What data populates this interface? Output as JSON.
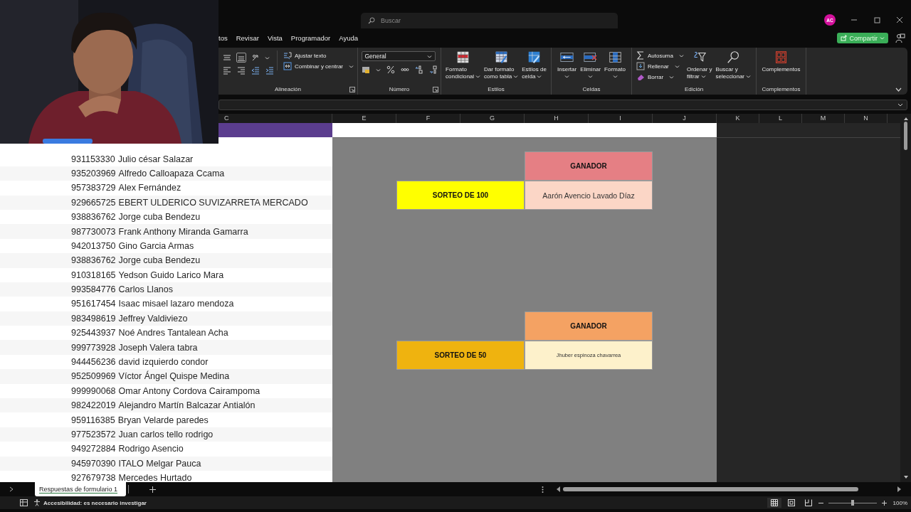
{
  "window": {
    "search_placeholder": "Buscar",
    "avatar": "AC"
  },
  "menu_tabs": [
    {
      "label": "tos"
    },
    {
      "label": "Revisar"
    },
    {
      "label": "Vista"
    },
    {
      "label": "Programador"
    },
    {
      "label": "Ayuda"
    }
  ],
  "share_button": "Compartir",
  "ribbon": [
    {
      "title": "Alineación",
      "launcher": true,
      "items": [
        {
          "kind": "align"
        },
        {
          "kind": "stack",
          "entries": [
            {
              "label": "Ajustar texto",
              "dropdown": false
            },
            {
              "label": "Combinar y centrar",
              "dropdown": true
            }
          ]
        }
      ]
    },
    {
      "title": "Número",
      "launcher": true,
      "items": [
        {
          "kind": "numfmt",
          "value": "General"
        }
      ]
    },
    {
      "title": "Estilos",
      "launcher": false,
      "items": [
        {
          "kind": "large",
          "lines": [
            "Formato",
            "condicional"
          ],
          "dropdown": true
        },
        {
          "kind": "large",
          "lines": [
            "Dar formato",
            "como tabla"
          ],
          "dropdown": true
        },
        {
          "kind": "large",
          "lines": [
            "Estilos de",
            "celda"
          ],
          "dropdown": true
        }
      ]
    },
    {
      "title": "Celdas",
      "launcher": false,
      "items": [
        {
          "kind": "large",
          "lines": [
            "Insertar"
          ],
          "dropdown": true
        },
        {
          "kind": "large",
          "lines": [
            "Eliminar"
          ],
          "dropdown": true
        },
        {
          "kind": "large",
          "lines": [
            "Formato"
          ],
          "dropdown": true
        }
      ]
    },
    {
      "title": "Edición",
      "launcher": false,
      "items": [
        {
          "kind": "stack",
          "entries": [
            {
              "label": "Autosuma",
              "dropdown": true
            },
            {
              "label": "Rellenar",
              "dropdown": true
            },
            {
              "label": "Borrar",
              "dropdown": true
            }
          ]
        },
        {
          "kind": "large",
          "lines": [
            "Ordenar y",
            "filtrar"
          ],
          "dropdown": true
        },
        {
          "kind": "large",
          "lines": [
            "Buscar y",
            "seleccionar"
          ],
          "dropdown": true
        }
      ]
    },
    {
      "title": "Complementos",
      "launcher": false,
      "items": [
        {
          "kind": "large",
          "lines": [
            "Complementos"
          ],
          "dropdown": false
        }
      ]
    }
  ],
  "columns": [
    "C",
    "E",
    "F",
    "G",
    "H",
    "I",
    "J",
    "K",
    "L",
    "M",
    "N"
  ],
  "rows": [
    {
      "phone": "931153330",
      "name": "Julio césar Salazar"
    },
    {
      "phone": "935203969",
      "name": "Alfredo Calloapaza Ccama"
    },
    {
      "phone": "957383729",
      "name": "Alex Fernández"
    },
    {
      "phone": "929665725",
      "name": "EBERT ULDERICO SUVIZARRETA MERCADO"
    },
    {
      "phone": "938836762",
      "name": "Jorge cuba Bendezu"
    },
    {
      "phone": "987730073",
      "name": "Frank Anthony Miranda Gamarra"
    },
    {
      "phone": "942013750",
      "name": "Gino Garcia Armas"
    },
    {
      "phone": "938836762",
      "name": "Jorge cuba Bendezu"
    },
    {
      "phone": "910318165",
      "name": "Yedson Guido Larico Mara"
    },
    {
      "phone": "993584776",
      "name": "Carlos Llanos"
    },
    {
      "phone": "951617454",
      "name": "Isaac misael lazaro mendoza"
    },
    {
      "phone": "983498619",
      "name": "Jeffrey Valdiviezo"
    },
    {
      "phone": "925443937",
      "name": "Noé Andres Tantalean Acha"
    },
    {
      "phone": "999773928",
      "name": "Joseph Valera tabra"
    },
    {
      "phone": "944456236",
      "name": "david izquierdo condor"
    },
    {
      "phone": "952509969",
      "name": "Víctor Ángel Quispe Medina"
    },
    {
      "phone": "999990068",
      "name": "Omar Antony Cordova Cairampoma"
    },
    {
      "phone": "982422019",
      "name": "Alejandro Martín Balcazar Antialón"
    },
    {
      "phone": "959116385",
      "name": "Bryan Velarde paredes"
    },
    {
      "phone": "977523572",
      "name": "Juan carlos tello rodrigo"
    },
    {
      "phone": "949272884",
      "name": "Rodrigo Asencio"
    },
    {
      "phone": "945970390",
      "name": "ITALO Melgar Pauca"
    },
    {
      "phone": "927679738",
      "name": "Mercedes Hurtado"
    }
  ],
  "draws": [
    {
      "header": {
        "text": "GANADOR",
        "color": "#e57f84"
      },
      "label": {
        "text": "SORTEO DE 100",
        "color": "#ffff00"
      },
      "winner": {
        "text": "Aarón Avencio Lavado Díaz",
        "color": "#fbd6c6"
      }
    },
    {
      "header": {
        "text": "GANADOR",
        "color": "#f4a263"
      },
      "label": {
        "text": "SORTEO DE 50",
        "color": "#efb30f"
      },
      "winner": {
        "text": "Jhuber espinoza chavarrea",
        "color": "#fdf1cb"
      }
    }
  ],
  "sheet_tabs": [
    {
      "label": "Respuestas de formulario 1",
      "selected": true
    }
  ],
  "status": {
    "accessibility": "Accesibilidad: es necesario investigar",
    "zoom": "100%",
    "zoom_slider": {
      "level": 0.51
    }
  }
}
